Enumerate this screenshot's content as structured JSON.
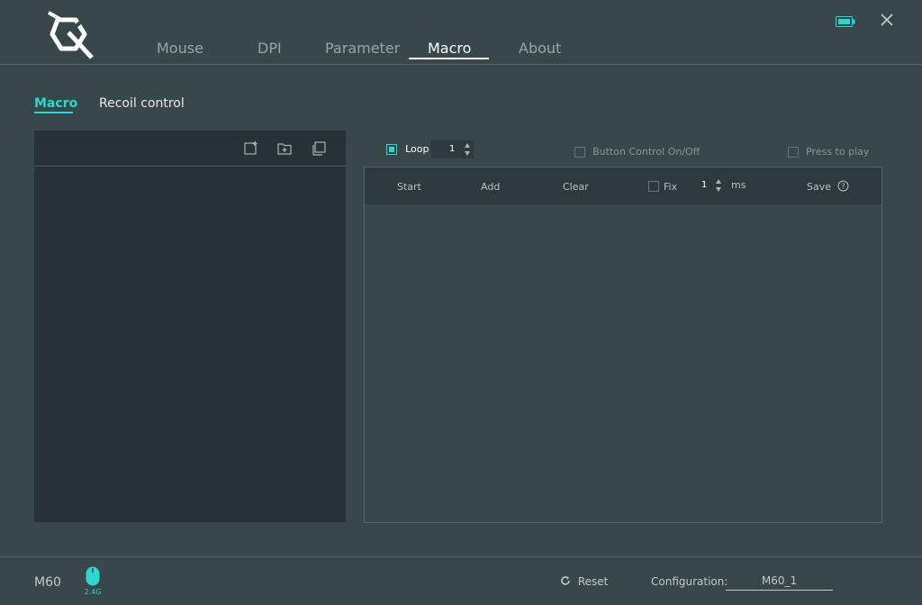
{
  "app": {
    "tabs": [
      "Mouse",
      "DPI",
      "Parameter",
      "Macro",
      "About"
    ],
    "active_tab": "Macro"
  },
  "subtabs": {
    "macro": "Macro",
    "recoil": "Recoil control"
  },
  "macro_list": {
    "icons": [
      "new-macro-icon",
      "import-macro-icon",
      "copy-macro-icon"
    ]
  },
  "controls": {
    "loop_label": "Loop",
    "loop_value": "1",
    "loop_checked": true,
    "button_control_label": "Button Control On/Off",
    "press_to_play_label": "Press to play"
  },
  "editor": {
    "start": "Start",
    "add": "Add",
    "clear": "Clear",
    "fix_label": "Fix",
    "fix_value": "1",
    "ms_label": "ms",
    "save": "Save"
  },
  "footer": {
    "model": "M60",
    "connection": "2.4G",
    "reset": "Reset",
    "config_label": "Configuration:",
    "config_value": "M60_1"
  },
  "colors": {
    "accent": "#2ad8d0",
    "background": "#37474a",
    "panel": "#273236"
  }
}
